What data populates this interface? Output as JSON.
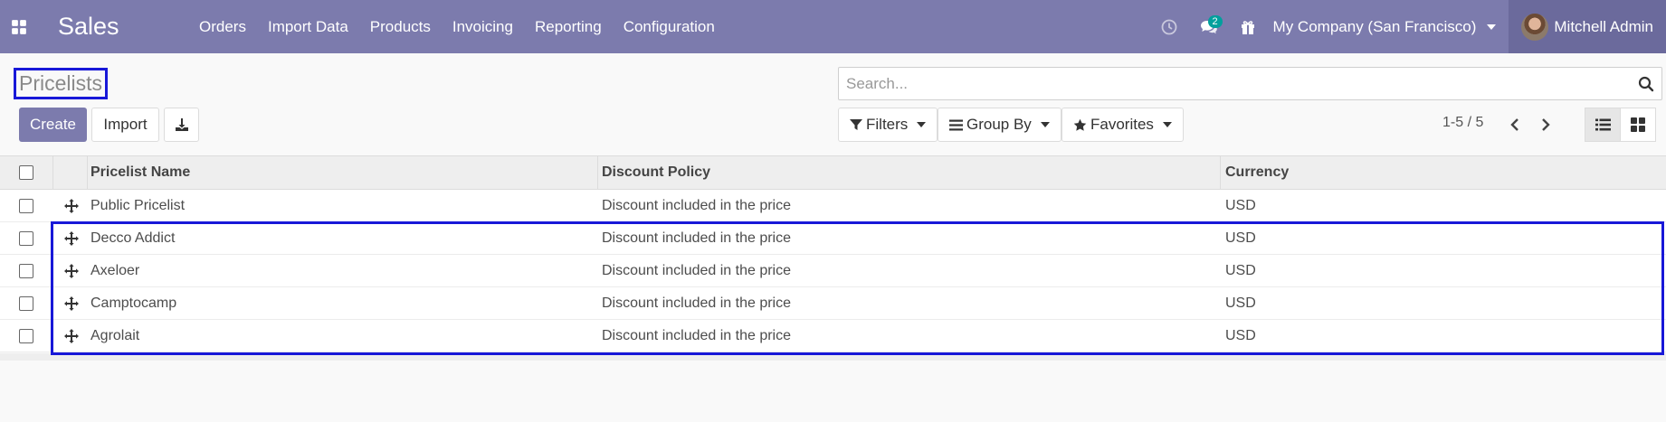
{
  "navbar": {
    "app_title": "Sales",
    "menu": [
      "Orders",
      "Import Data",
      "Products",
      "Invoicing",
      "Reporting",
      "Configuration"
    ],
    "messages_count": "2",
    "company": "My Company (San Francisco)",
    "user": "Mitchell Admin"
  },
  "control_panel": {
    "title": "Pricelists",
    "search_placeholder": "Search...",
    "create_label": "Create",
    "import_label": "Import",
    "filters_label": "Filters",
    "group_by_label": "Group By",
    "favorites_label": "Favorites",
    "pager": "1-5 / 5"
  },
  "table": {
    "columns": [
      "Pricelist Name",
      "Discount Policy",
      "Currency"
    ],
    "rows": [
      {
        "name": "Public Pricelist",
        "policy": "Discount included in the price",
        "currency": "USD"
      },
      {
        "name": "Decco Addict",
        "policy": "Discount included in the price",
        "currency": "USD"
      },
      {
        "name": "Axeloer",
        "policy": "Discount included in the price",
        "currency": "USD"
      },
      {
        "name": "Camptocamp",
        "policy": "Discount included in the price",
        "currency": "USD"
      },
      {
        "name": "Agrolait",
        "policy": "Discount included in the price",
        "currency": "USD"
      }
    ]
  },
  "colors": {
    "navbar": "#7c7bad",
    "user_menu": "#6b6a9c",
    "badge": "#00a09d",
    "highlight": "#1818d8"
  },
  "icons": [
    "apps-grid-icon",
    "clock-icon",
    "chat-icon",
    "gift-icon",
    "search-icon",
    "download-icon",
    "filter-icon",
    "group-by-icon",
    "star-icon",
    "chevron-left-icon",
    "chevron-right-icon",
    "list-view-icon",
    "kanban-view-icon",
    "drag-handle-icon"
  ]
}
